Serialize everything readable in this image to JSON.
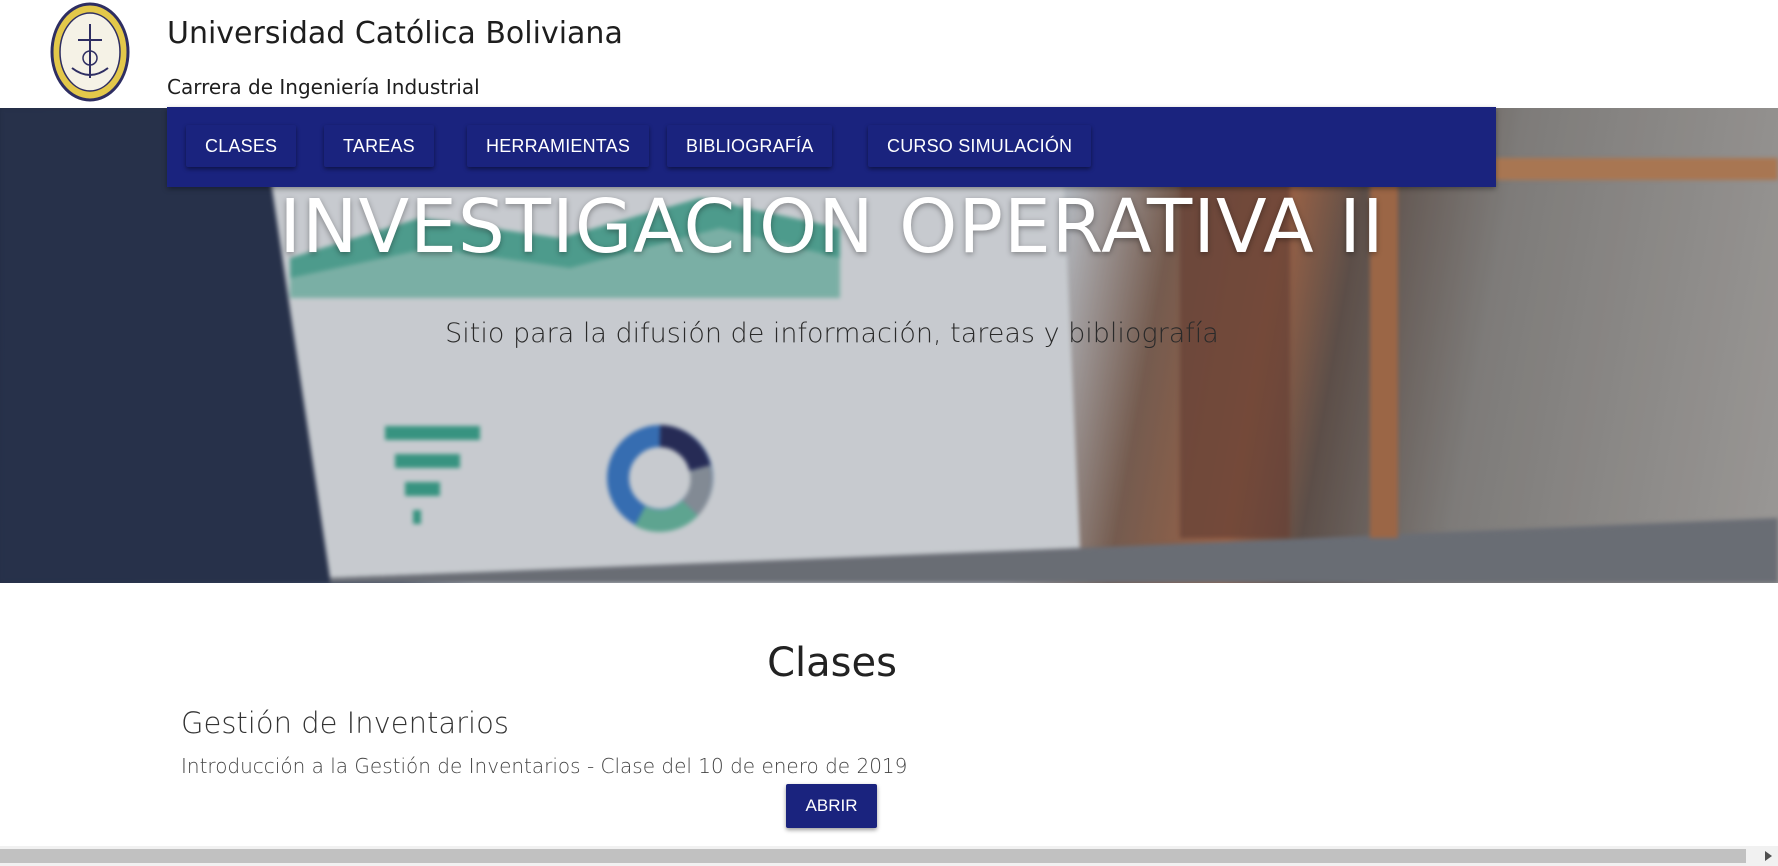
{
  "header": {
    "title": "Universidad Católica Boliviana",
    "subtitle": "Carrera de Ingeniería Industrial",
    "logo_icon": "university-seal-icon"
  },
  "nav": {
    "items": [
      {
        "label": "CLASES"
      },
      {
        "label": "TAREAS"
      },
      {
        "label": "HERRAMIENTAS"
      },
      {
        "label": "BIBLIOGRAFÍA"
      },
      {
        "label": "CURSO SIMULACIÓN"
      }
    ]
  },
  "hero": {
    "title": "INVESTIGACION OPERATIVA II",
    "subtitle": "Sitio para la difusión de información, tareas y bibliografía"
  },
  "section": {
    "title": "Clases",
    "items": [
      {
        "title": "Gestión de Inventarios",
        "description": "Introducción a la Gestión de Inventarios - Clase del 10 de enero de 2019",
        "button_label": "ABRIR"
      }
    ]
  },
  "colors": {
    "primary": "#1a237e",
    "text": "#222222",
    "background": "#ffffff"
  }
}
